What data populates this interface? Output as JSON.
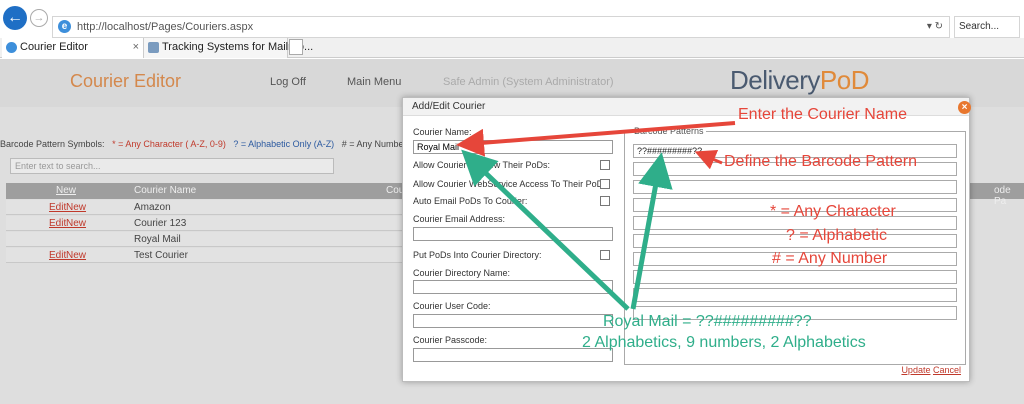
{
  "browser": {
    "url": "http://localhost/Pages/Couriers.aspx",
    "search_placeholder": "Search...",
    "tabs": [
      {
        "label": "Courier Editor",
        "active": true
      },
      {
        "label": "Tracking Systems for Mailroo...",
        "active": false
      }
    ]
  },
  "header": {
    "app_title": "Courier Editor",
    "nav": [
      "Log Off",
      "Main Menu",
      "Safe Admin (System Administrator)"
    ],
    "logo_part1": "Delivery",
    "logo_part2": "PoD"
  },
  "legend": {
    "prefix": "Barcode Pattern Symbols:",
    "any": "* = Any Character ( A-Z, 0-9)",
    "alpha": "? = Alphabetic Only (A-Z)",
    "num": "# = Any Number"
  },
  "filter": {
    "placeholder": "Enter text to search..."
  },
  "grid": {
    "headers": [
      "New",
      "Courier Name",
      "Cou",
      "ode Pa"
    ],
    "rows": [
      {
        "edit": "Edit",
        "new": "New",
        "name": "Amazon"
      },
      {
        "edit": "Edit",
        "new": "New",
        "name": "Courier 123"
      },
      {
        "edit": "",
        "new": "",
        "name": "Royal Mail"
      },
      {
        "edit": "Edit",
        "new": "New",
        "name": "Test Courier"
      }
    ]
  },
  "dialog": {
    "title": "Add/Edit Courier",
    "courier_name_label": "Courier Name:",
    "courier_name_value": "Royal Mail",
    "allow_view_label": "Allow Courier To View Their PoDs:",
    "allow_ws_label": "Allow Courier WebService Access To Their PoDs:",
    "auto_email_label": "Auto Email PoDs To Courier:",
    "email_label": "Courier Email Address:",
    "put_dir_label": "Put PoDs Into Courier Directory:",
    "dir_name_label": "Courier Directory Name:",
    "user_code_label": "Courier User Code:",
    "passcode_label": "Courier Passcode:",
    "barcode_legend": "Barcode Patterns",
    "barcode_value": "??#########??",
    "update": "Update",
    "cancel": "Cancel"
  },
  "annotations": {
    "enter_name": "Enter the Courier Name",
    "define_pattern": "Define the Barcode Pattern",
    "star": "* = Any Character",
    "question": "? = Alphabetic",
    "hash": "# = Any Number",
    "royal": "Royal Mail = ??#########??",
    "explain": "2 Alphabetics, 9 numbers, 2 Alphabetics"
  },
  "colors": {
    "annotation_red": "#e6463a",
    "annotation_green": "#2fae8a",
    "brand_orange": "#e08a3a"
  }
}
